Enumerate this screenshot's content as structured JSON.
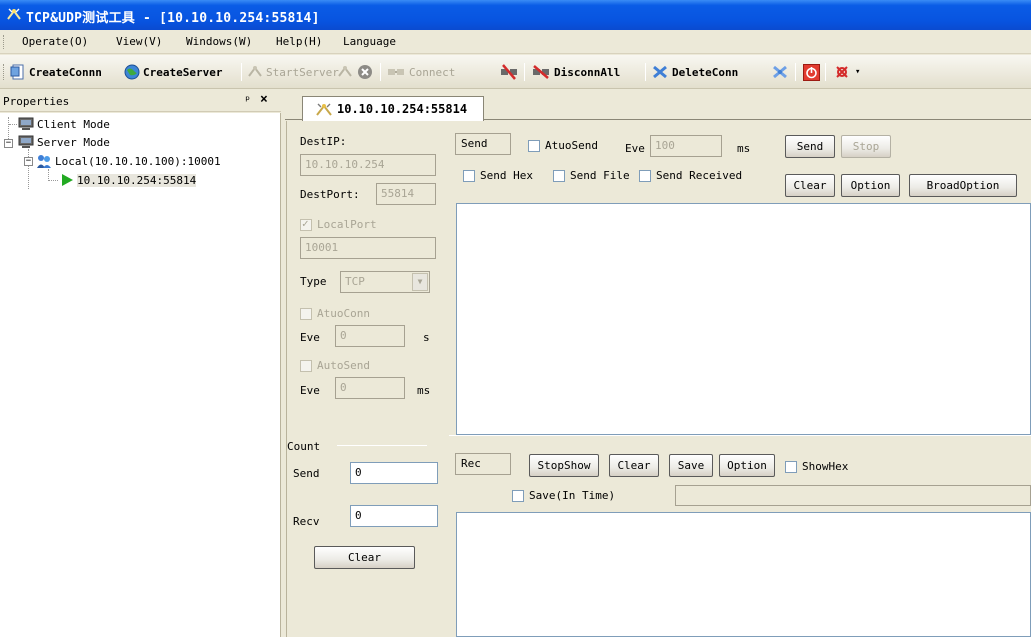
{
  "window": {
    "title": "TCP&UDP测试工具 - [10.10.10.254:55814]"
  },
  "menu": [
    {
      "label": "Operate(O)"
    },
    {
      "label": "View(V)"
    },
    {
      "label": "Windows(W)"
    },
    {
      "label": "Help(H)"
    },
    {
      "label": "Language"
    }
  ],
  "toolbar": {
    "create_conn": "CreateConnn",
    "create_server": "CreateServer",
    "start_server": "StartServer",
    "connect": "Connect",
    "disconn_all": "DisconnAll",
    "delete_conn": "DeleteConn"
  },
  "properties": {
    "title": "Properties",
    "pin": "ᵖ",
    "close": "×"
  },
  "tree": {
    "client_mode": "Client Mode",
    "server_mode": "Server Mode",
    "local": "Local(10.10.10.100):10001",
    "connection": "10.10.10.254:55814"
  },
  "tab": {
    "label": "10.10.10.254:55814"
  },
  "conn": {
    "dest_ip_label": "DestIP:",
    "dest_ip_value": "10.10.10.254",
    "dest_port_label": "DestPort:",
    "dest_port_value": "55814",
    "local_port_label": "LocalPort",
    "local_port_value": "10001",
    "type_label": "Type",
    "type_value": "TCP",
    "auto_conn_label": "AtuoConn",
    "eve_label_1": "Eve",
    "eve_value_1": "0",
    "eve_unit_1": "s",
    "auto_send_label": "AutoSend",
    "eve_label_2": "Eve",
    "eve_value_2": "0",
    "eve_unit_2": "ms"
  },
  "count": {
    "title": "Count",
    "send_label": "Send",
    "send_value": "0",
    "recv_label": "Recv",
    "recv_value": "0",
    "clear_label": "Clear"
  },
  "send_panel": {
    "label": "Send",
    "auto_send_label": "AtuoSend",
    "eve_label": "Eve",
    "eve_value": "100",
    "ms_label": "ms",
    "send_button": "Send",
    "stop_button": "Stop",
    "send_hex": "Send Hex",
    "send_file": "Send File",
    "send_received": "Send Received",
    "clear_button": "Clear",
    "option_button": "Option",
    "broad_option_button": "BroadOption"
  },
  "rec_panel": {
    "label": "Rec",
    "stop_show": "StopShow",
    "clear": "Clear",
    "save": "Save",
    "option": "Option",
    "show_hex": "ShowHex",
    "save_in_time": "Save(In Time)"
  },
  "icons": {
    "app": "satellite-dish-icon",
    "create_conn": "new-document-icon",
    "create_server": "globe-icon",
    "start_server": "server-start-icon",
    "stop_server": "stop-circle-icon",
    "connect": "plug-connect-icon",
    "disconnect": "plug-disconnect-icon",
    "disconn_all": "disconnect-all-icon",
    "delete_conn": "delete-connection-icon",
    "power": "power-icon"
  },
  "colors": {
    "titlebar": "#0854e0",
    "tree_arrow": "#22aa22"
  }
}
